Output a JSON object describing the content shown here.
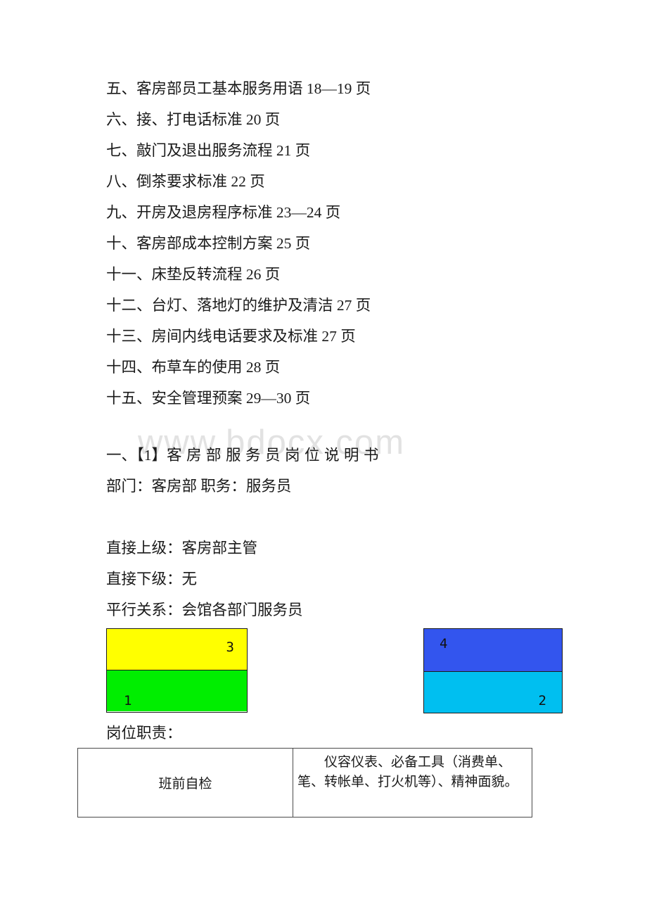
{
  "document": {
    "watermark": "www.bdocx.com",
    "toc": {
      "items": [
        {
          "text": "五、客房部员工基本服务用语 18—19 页"
        },
        {
          "text": "六、接、打电话标准  20 页"
        },
        {
          "text": "七、敲门及退出服务流程  21 页"
        },
        {
          "text": "八、倒茶要求标准  22 页"
        },
        {
          "text": "九、开房及退房程序标准  23—24 页"
        },
        {
          "text": "十、客房部成本控制方案  25 页"
        },
        {
          "text": "十一、床垫反转流程  26 页"
        },
        {
          "text": "十二、台灯、落地灯的维护及清洁  27 页"
        },
        {
          "text": "十三、房间内线电话要求及标准  27 页"
        },
        {
          "text": "十四、布草车的使用  28 页"
        },
        {
          "text": "十五、安全管理预案  29—30 页"
        }
      ]
    },
    "section": {
      "title_prefix": "一、【1】",
      "title_spaced": "客房部服务员岗位说明书",
      "subtitle": "部门：客房部 职务：服务员",
      "relations": [
        {
          "text": "直接上级：客房部主管"
        },
        {
          "text": "直接下级：无"
        },
        {
          "text": "平行关系：会馆各部门服务员"
        }
      ]
    },
    "diagram": {
      "left_group": {
        "top_cell": {
          "number": "3",
          "color": "#FFFF00"
        },
        "bottom_cell": {
          "number": "1",
          "color": "#00EE00"
        }
      },
      "right_group": {
        "top_cell": {
          "number": "4",
          "color": "#3355EE"
        },
        "bottom_cell": {
          "number": "2",
          "color": "#00BFF0"
        }
      }
    },
    "duties": {
      "label": "岗位职责：",
      "rows": [
        {
          "item": "班前自检",
          "detail": "仪容仪表、必备工具（消费单、笔、转帐单、打火机等）、精神面貌。"
        }
      ]
    }
  }
}
